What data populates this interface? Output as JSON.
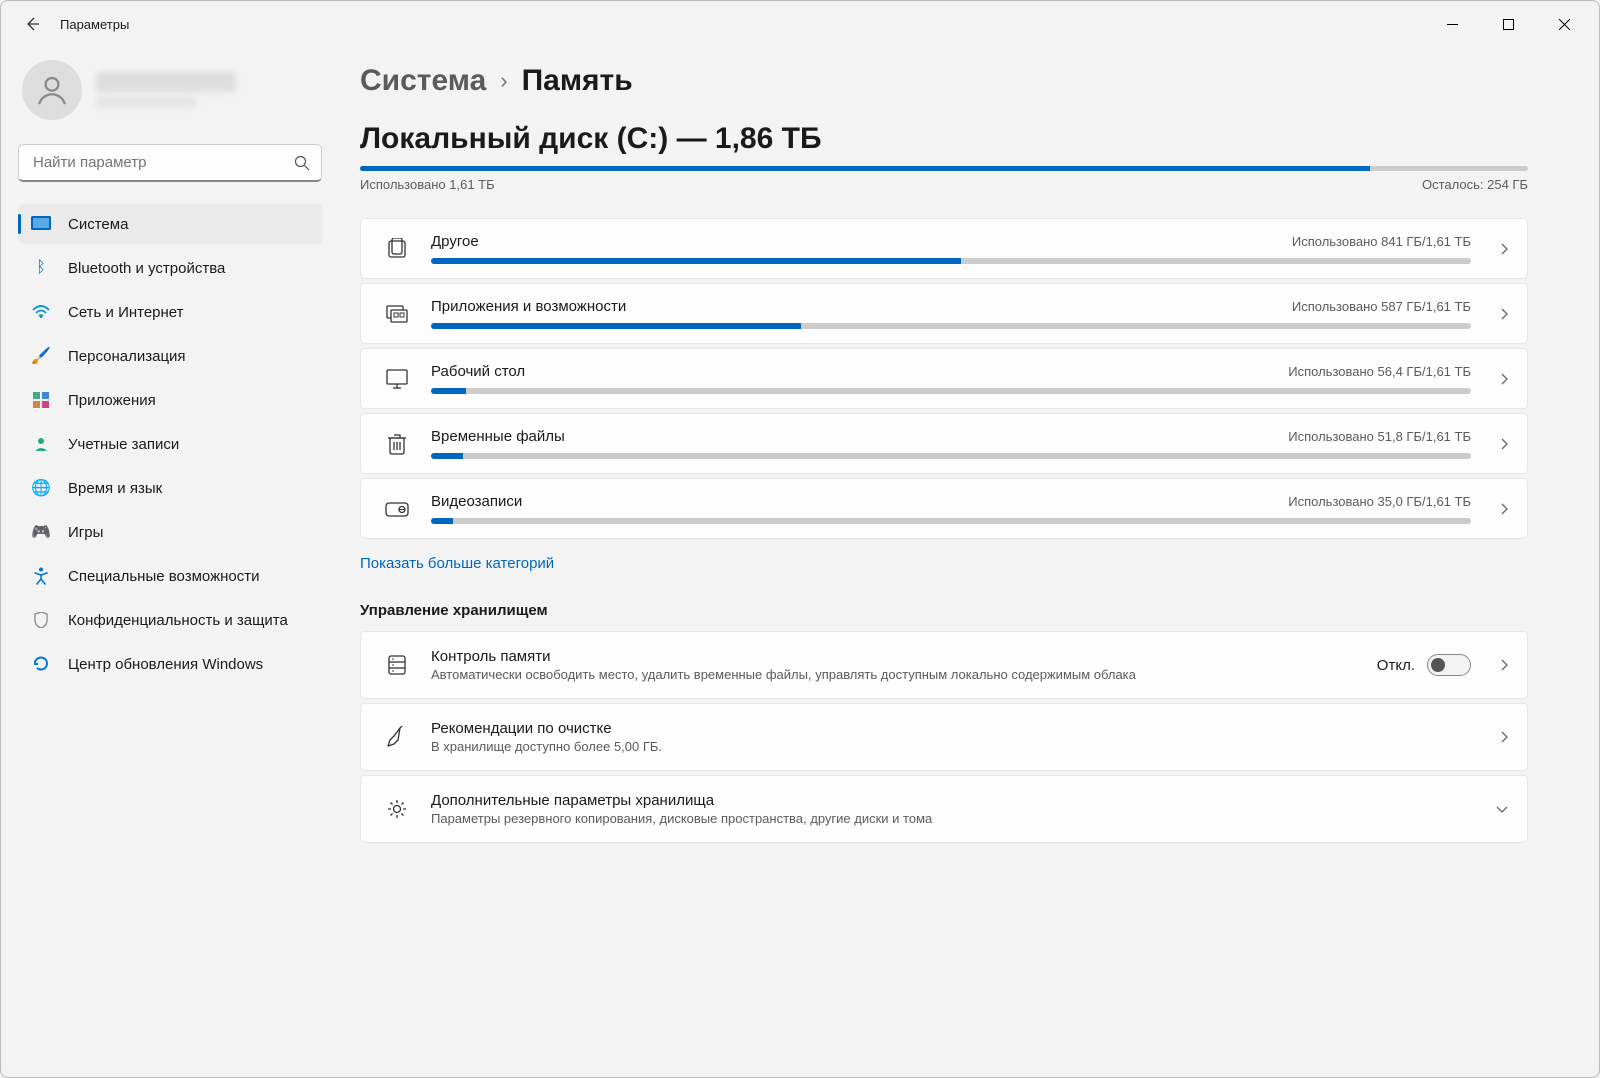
{
  "titlebar": {
    "title": "Параметры"
  },
  "search": {
    "placeholder": "Найти параметр"
  },
  "nav": {
    "items": [
      "Система",
      "Bluetooth и устройства",
      "Сеть и Интернет",
      "Персонализация",
      "Приложения",
      "Учетные записи",
      "Время и язык",
      "Игры",
      "Специальные возможности",
      "Конфиденциальность и защита",
      "Центр обновления Windows"
    ]
  },
  "breadcrumb": {
    "parent": "Система",
    "current": "Память"
  },
  "disk": {
    "title": "Локальный диск (C:) — 1,86 ТБ",
    "used_label": "Использовано 1,61 ТБ",
    "free_label": "Осталось: 254 ГБ",
    "fill_percent": 86.5
  },
  "categories": [
    {
      "name": "Другое",
      "usage": "Использовано 841 ГБ/1,61 ТБ",
      "percent": 51
    },
    {
      "name": "Приложения и возможности",
      "usage": "Использовано 587 ГБ/1,61 ТБ",
      "percent": 35.6
    },
    {
      "name": "Рабочий стол",
      "usage": "Использовано 56,4 ГБ/1,61 ТБ",
      "percent": 3.4
    },
    {
      "name": "Временные файлы",
      "usage": "Использовано 51,8 ГБ/1,61 ТБ",
      "percent": 3.1
    },
    {
      "name": "Видеозаписи",
      "usage": "Использовано 35,0 ГБ/1,61 ТБ",
      "percent": 2.1
    }
  ],
  "show_more": "Показать больше категорий",
  "mgmt": {
    "heading": "Управление хранилищем",
    "sense": {
      "title": "Контроль памяти",
      "desc": "Автоматически освободить место, удалить временные файлы, управлять доступным локально содержимым облака",
      "state": "Откл."
    },
    "cleanup": {
      "title": "Рекомендации по очистке",
      "desc": "В хранилище доступно более 5,00 ГБ."
    },
    "advanced": {
      "title": "Дополнительные параметры хранилища",
      "desc": "Параметры резервного копирования, дисковые пространства, другие диски и тома"
    }
  }
}
